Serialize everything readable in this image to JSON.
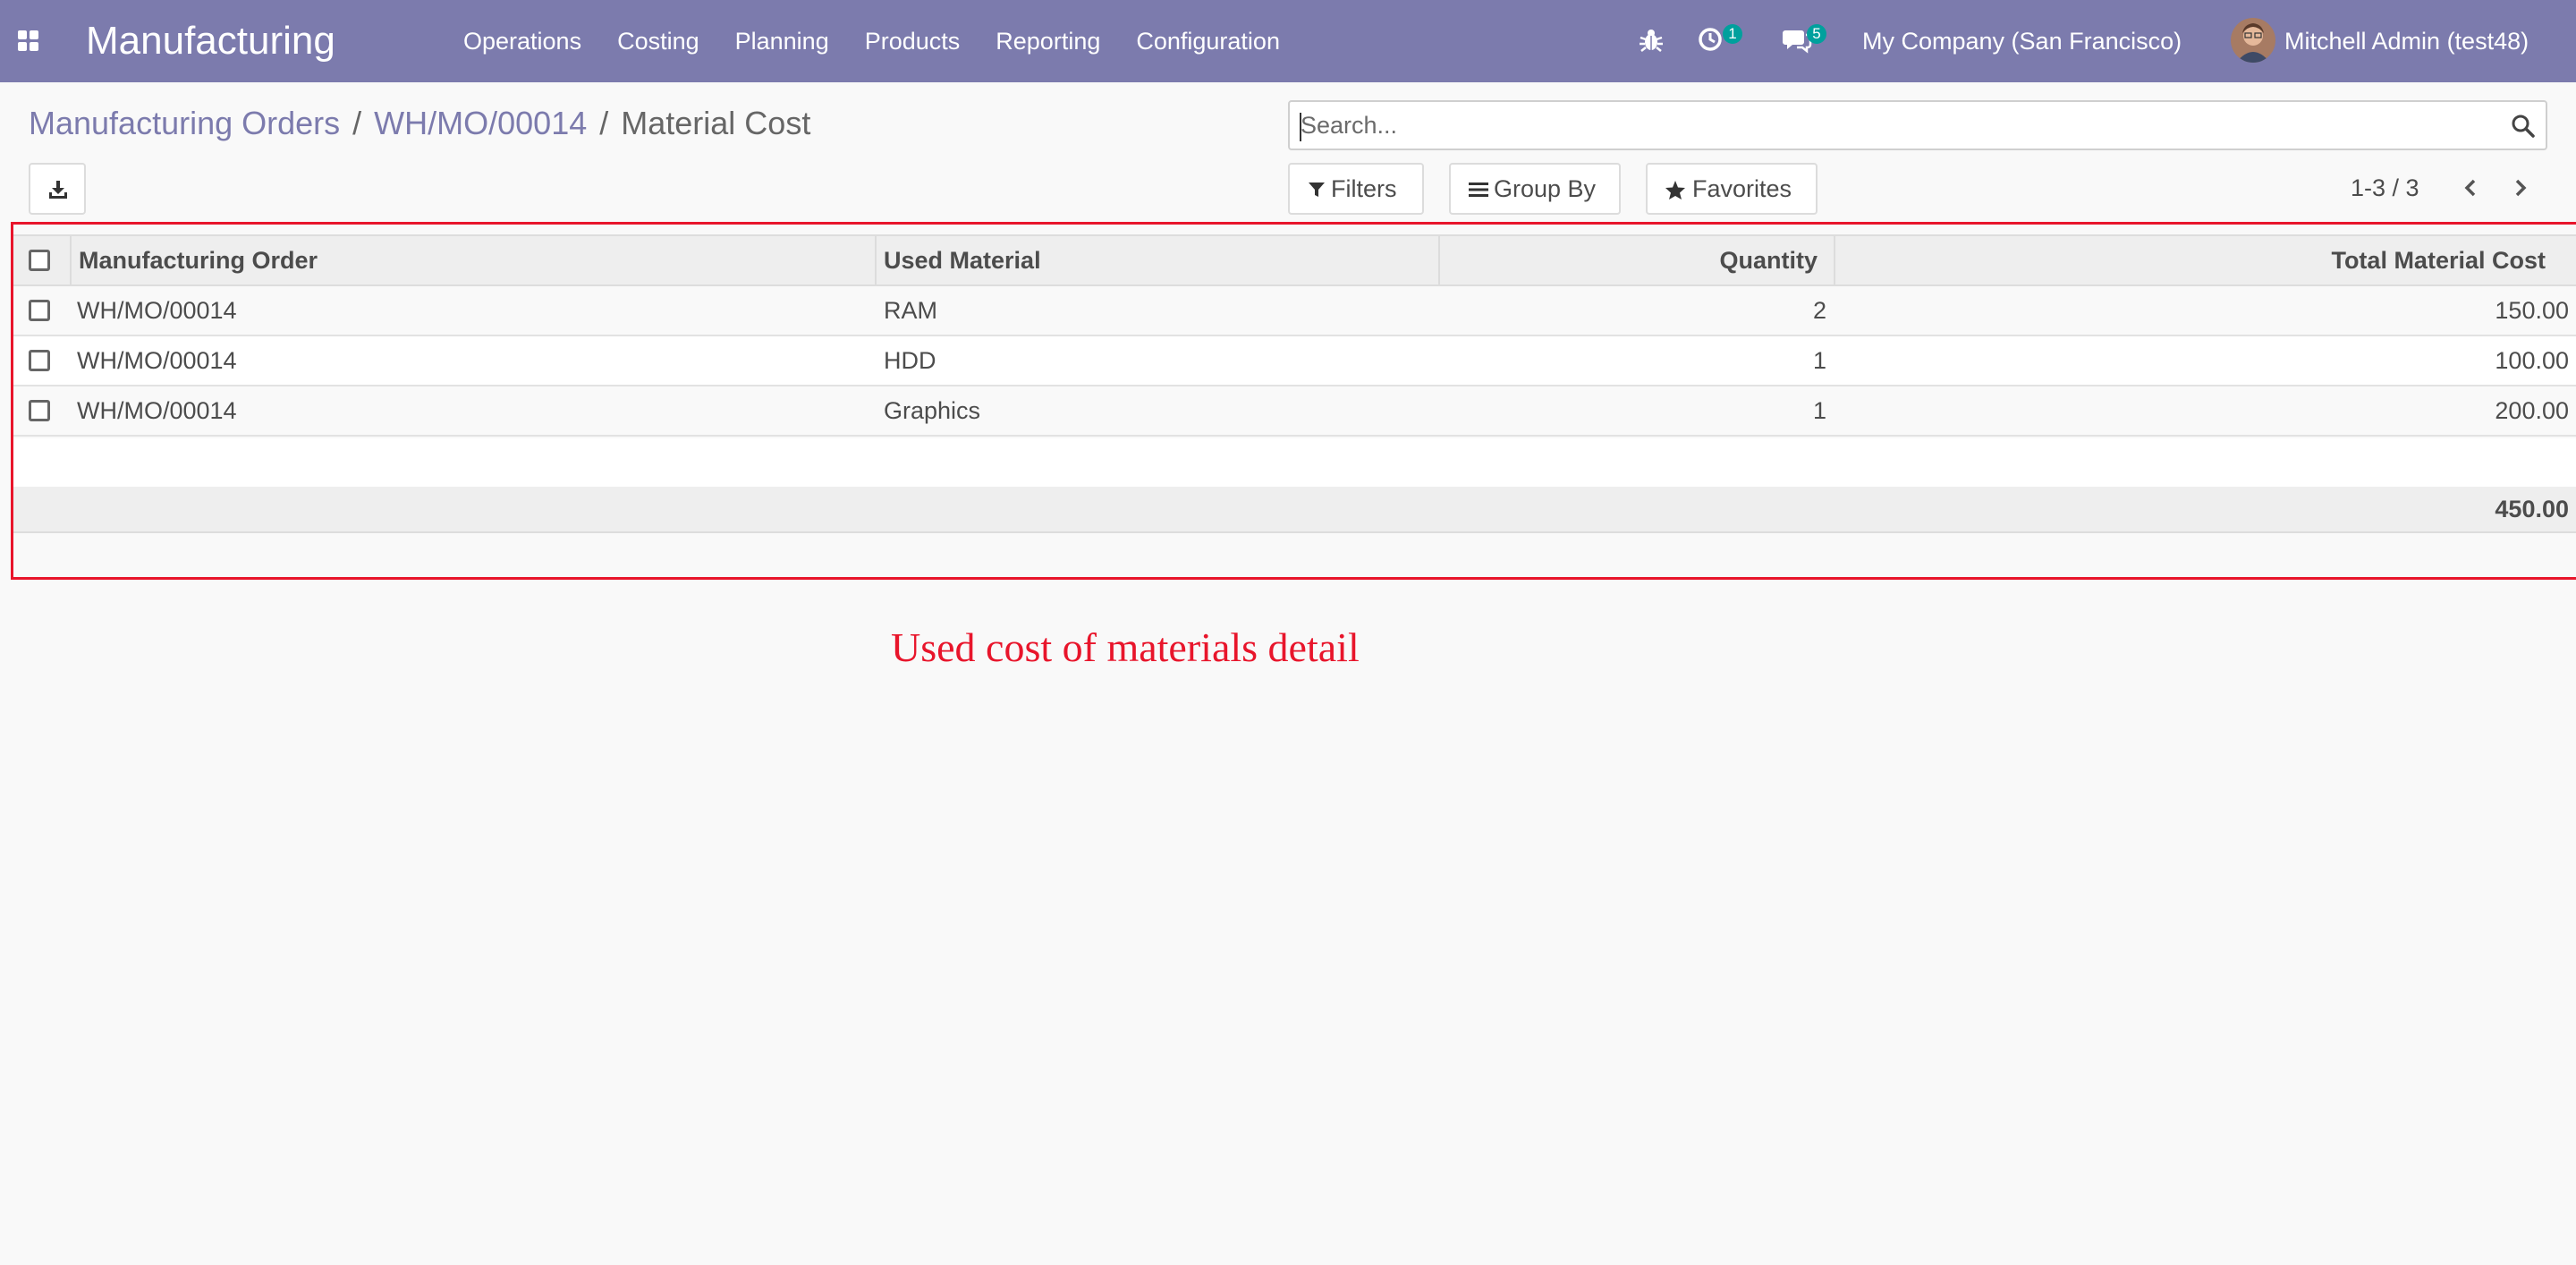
{
  "navbar": {
    "app_name": "Manufacturing",
    "menu": [
      "Operations",
      "Costing",
      "Planning",
      "Products",
      "Reporting",
      "Configuration"
    ],
    "activity_count": "1",
    "message_count": "5",
    "company": "My Company (San Francisco)",
    "user": "Mitchell Admin (test48)",
    "icons": [
      "apps-icon",
      "bug-icon",
      "clock-icon",
      "chat-icon",
      "avatar"
    ]
  },
  "breadcrumb": {
    "items": [
      "Manufacturing Orders",
      "WH/MO/00014"
    ],
    "separator": "/",
    "current": "Material Cost"
  },
  "search": {
    "placeholder": "Search...",
    "value": ""
  },
  "filters": {
    "filters_label": "Filters",
    "group_by_label": "Group By",
    "favorites_label": "Favorites"
  },
  "pager": {
    "value": "1-3 / 3"
  },
  "table": {
    "columns": [
      "Manufacturing Order",
      "Used Material",
      "Quantity",
      "Total Material Cost"
    ],
    "rows": [
      {
        "order": "WH/MO/00014",
        "material": "RAM",
        "quantity": "2",
        "cost": "150.00"
      },
      {
        "order": "WH/MO/00014",
        "material": "HDD",
        "quantity": "1",
        "cost": "100.00"
      },
      {
        "order": "WH/MO/00014",
        "material": "Graphics",
        "quantity": "1",
        "cost": "200.00"
      }
    ],
    "total_cost": "450.00"
  },
  "annotation": {
    "text": "Used cost of materials detail",
    "color": "#e8152b"
  },
  "colors": {
    "navbar": "#7c7bad",
    "accent": "#7c7bad",
    "badge": "#00a09d",
    "annotation": "#e8152b"
  }
}
